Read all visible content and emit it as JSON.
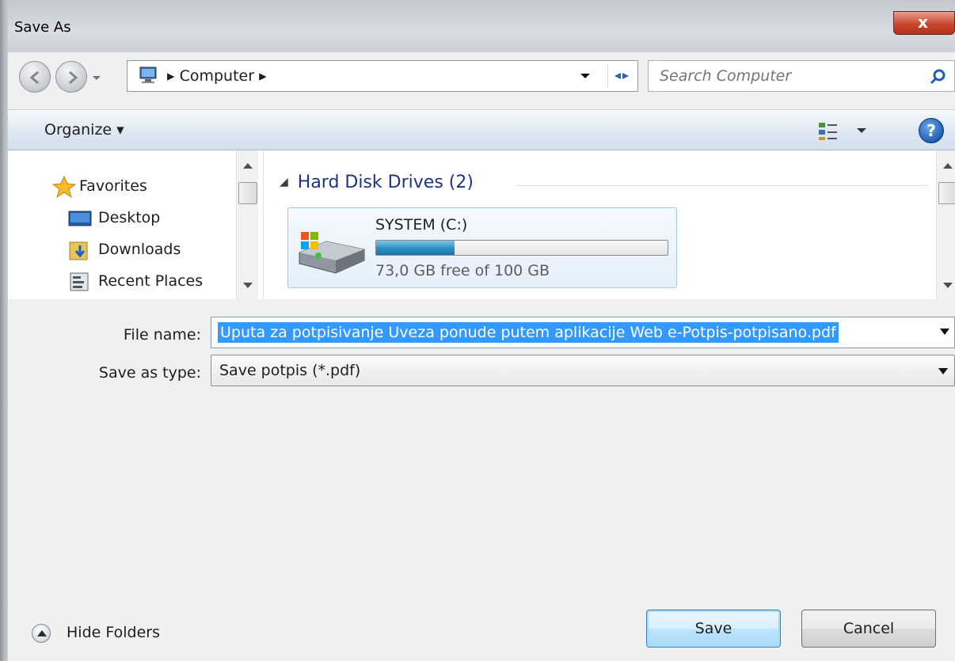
{
  "window": {
    "title": "Save As",
    "close_label": "x"
  },
  "navigation": {
    "address_segments": [
      "Computer"
    ],
    "search_placeholder": "Search Computer"
  },
  "command_bar": {
    "organize_label": "Organize",
    "help_label": "?"
  },
  "sidebar": {
    "items": [
      {
        "label": "Favorites",
        "icon": "star-icon"
      },
      {
        "label": "Desktop",
        "icon": "desktop-icon"
      },
      {
        "label": "Downloads",
        "icon": "downloads-folder-icon"
      },
      {
        "label": "Recent Places",
        "icon": "recent-places-icon"
      }
    ]
  },
  "content": {
    "group_header": "Hard Disk Drives (2)",
    "drives": [
      {
        "name": "SYSTEM (C:)",
        "free_text": "73,0 GB free of 100 GB",
        "used_fraction": 0.27,
        "icon": "hard-drive-icon"
      }
    ]
  },
  "form": {
    "file_name_label": "File name:",
    "file_name_value": "Uputa za potpisivanje Uveza ponude putem aplikacije Web e-Potpis-potpisano.pdf",
    "save_as_type_label": "Save as type:",
    "save_as_type_value": "Save potpis (*.pdf)"
  },
  "footer": {
    "hide_folders_label": "Hide Folders",
    "save_label": "Save",
    "cancel_label": "Cancel"
  },
  "colors": {
    "selection": "#3399ff",
    "group_header": "#1e3287",
    "drive_bar": "#2a8fc4"
  }
}
